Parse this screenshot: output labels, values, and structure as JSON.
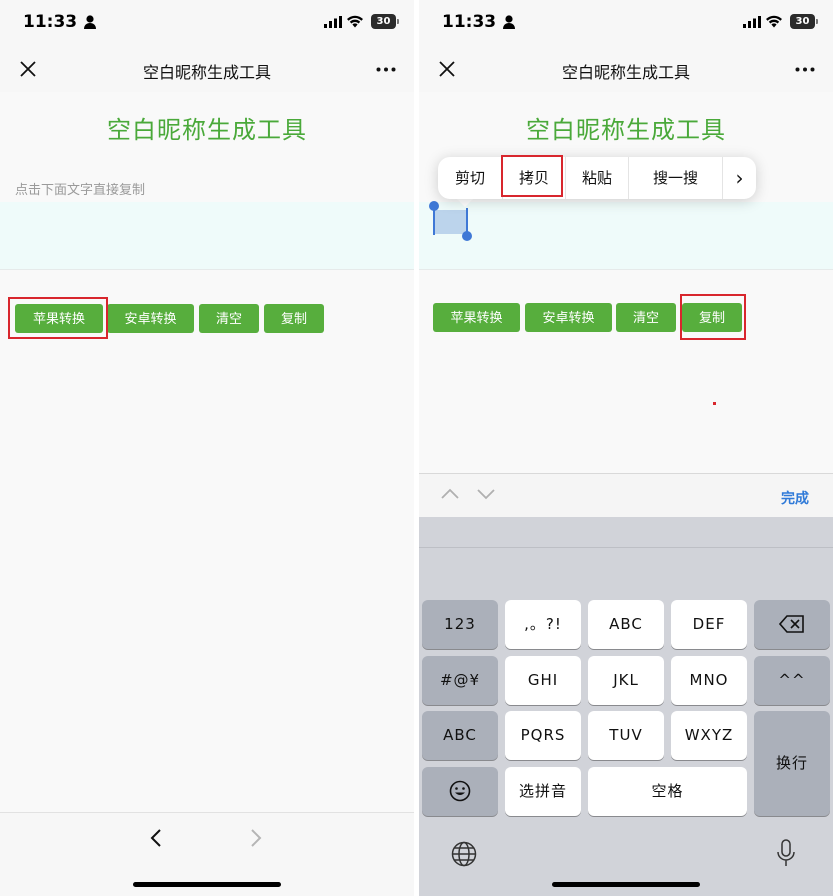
{
  "status": {
    "time": "11:33",
    "battery": "30"
  },
  "nav": {
    "title": "空白昵称生成工具"
  },
  "app": {
    "title": "空白昵称生成工具",
    "hint": "点击下面文字直接复制",
    "buttons": {
      "apple": "苹果转换",
      "android": "安卓转换",
      "clear": "清空",
      "copy": "复制"
    }
  },
  "context_menu": {
    "items": [
      "剪切",
      "拷贝",
      "粘贴",
      "搜一搜"
    ],
    "more": "›"
  },
  "keyboard_accessory": {
    "done": "完成"
  },
  "keyboard": {
    "row1": [
      "123",
      ",。?!",
      "ABC",
      "DEF"
    ],
    "row2": [
      "#@¥",
      "GHI",
      "JKL",
      "MNO",
      "^^"
    ],
    "row3": [
      "ABC",
      "PQRS",
      "TUV",
      "WXYZ"
    ],
    "row4": [
      "选拼音",
      "空格"
    ],
    "enter": "换行"
  },
  "colors": {
    "accent": "#57ae3d",
    "title_green": "#4aa93a",
    "highlight": "#d8262d",
    "link_blue": "#2f7ad8"
  }
}
